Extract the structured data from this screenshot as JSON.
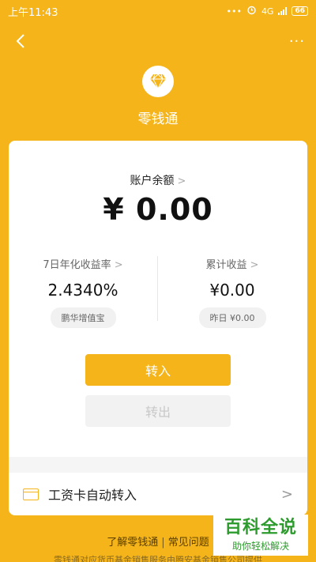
{
  "status_bar": {
    "time": "上午11:43",
    "dots": "•••",
    "network": "4G",
    "battery": "66"
  },
  "nav": {
    "more": "···"
  },
  "product": {
    "title": "零钱通"
  },
  "balance": {
    "label": "账户余额",
    "chevron": ">",
    "value": "¥ 0.00"
  },
  "yield": {
    "label": "7日年化收益率",
    "chevron": ">",
    "value": "2.4340%",
    "fund": "鹏华增值宝"
  },
  "cumulative": {
    "label": "累计收益",
    "chevron": ">",
    "value": "¥0.00",
    "yesterday": "昨日 ¥0.00"
  },
  "actions": {
    "transfer_in": "转入",
    "transfer_out": "转出"
  },
  "auto_transfer": {
    "label": "工资卡自动转入",
    "chevron": ">"
  },
  "footer": {
    "learn": "了解零钱通",
    "separator": "|",
    "faq": "常见问题",
    "disclaimer": "零钱通对应货币基金销售服务由腾安基金销售公司提供"
  },
  "watermark": {
    "title": "百科全说",
    "subtitle": "助你轻松解决"
  },
  "colors": {
    "brand": "#F4B41A",
    "watermark_green": "#2D9B2D"
  }
}
